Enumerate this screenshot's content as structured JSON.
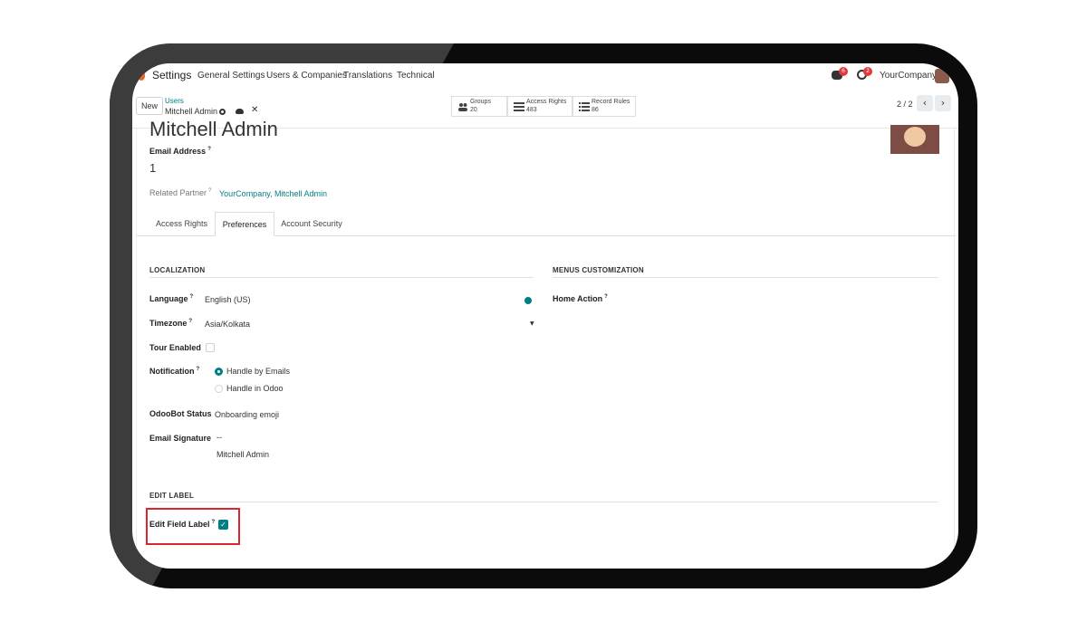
{
  "nav": {
    "app": "Settings",
    "menu": [
      "General Settings",
      "Users & Companies",
      "Translations",
      "Technical"
    ],
    "messages_badge": "6",
    "activities_badge": "2",
    "company": "YourCompany"
  },
  "control": {
    "new_label": "New",
    "breadcrumb_parent": "Users",
    "breadcrumb_current": "Mitchell Admin",
    "smart_buttons": [
      {
        "label": "Groups",
        "value": "20",
        "icon": "users-icon"
      },
      {
        "label": "Access Rights",
        "value": "483",
        "icon": "list-icon"
      },
      {
        "label": "Record Rules",
        "value": "86",
        "icon": "list-icon"
      }
    ],
    "pager": "2 / 2"
  },
  "form": {
    "name": "Mitchell Admin",
    "email_label": "Email Address",
    "email_value": "1",
    "related_label": "Related Partner",
    "related_value": "YourCompany, Mitchell Admin",
    "help_mark": "?"
  },
  "tabs": [
    "Access Rights",
    "Preferences",
    "Account Security"
  ],
  "localization": {
    "heading": "LOCALIZATION",
    "language_label": "Language",
    "language_value": "English (US)",
    "timezone_label": "Timezone",
    "timezone_value": "Asia/Kolkata",
    "tour_label": "Tour Enabled",
    "notification_label": "Notification",
    "notification_options": [
      "Handle by Emails",
      "Handle in Odoo"
    ],
    "odoobot_label": "OdooBot Status",
    "odoobot_value": "Onboarding emoji",
    "signature_label": "Email Signature",
    "signature_dash": "--",
    "signature_value": "Mitchell Admin"
  },
  "menus": {
    "heading": "MENUS CUSTOMIZATION",
    "home_label": "Home Action"
  },
  "edit_label": {
    "heading": "EDIT LABEL",
    "field_label": "Edit Field Label",
    "checked": true
  },
  "colors": {
    "accent": "#017e84",
    "highlight": "#d9262f",
    "badge": "#e03a3a"
  }
}
